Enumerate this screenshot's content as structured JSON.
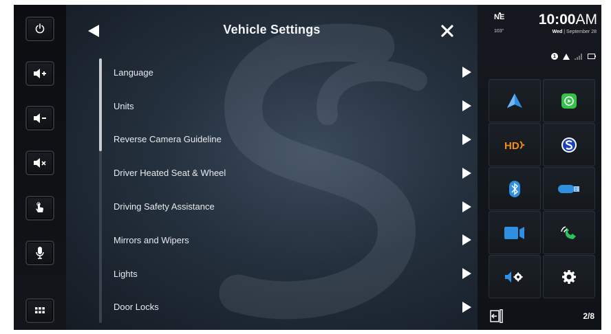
{
  "left_buttons": [
    {
      "name": "power-button",
      "icon": "power-icon"
    },
    {
      "name": "volume-up-button",
      "icon": "volume-up-icon"
    },
    {
      "name": "volume-down-button",
      "icon": "volume-down-icon"
    },
    {
      "name": "mute-button",
      "icon": "mute-icon"
    },
    {
      "name": "touch-button",
      "icon": "touch-hand-icon"
    },
    {
      "name": "voice-button",
      "icon": "microphone-icon"
    },
    {
      "name": "apps-button",
      "icon": "apps-grid-icon"
    }
  ],
  "header": {
    "title": "Vehicle Settings",
    "back_icon": "back-arrow-icon",
    "close_icon": "close-icon"
  },
  "menu": {
    "items": [
      {
        "label": "Language"
      },
      {
        "label": "Units"
      },
      {
        "label": "Reverse Camera Guideline"
      },
      {
        "label": "Driver Heated Seat & Wheel"
      },
      {
        "label": "Driving Safety Assistance"
      },
      {
        "label": "Mirrors and Wipers"
      },
      {
        "label": "Lights"
      },
      {
        "label": "Door Locks"
      }
    ],
    "scroll_fraction_visible": 0.35
  },
  "status": {
    "compass": "NE",
    "heading": "103°",
    "time": "10:00",
    "ampm": "AM",
    "day": "Wed",
    "date": "September 28",
    "notification_count": "1",
    "page": "2/8"
  },
  "tiles": [
    {
      "name": "navigation-tile",
      "icon": "navigation-arrow-icon"
    },
    {
      "name": "carplay-tile",
      "icon": "carplay-icon"
    },
    {
      "name": "hd-radio-tile",
      "icon": "hd-radio-icon"
    },
    {
      "name": "siriusxm-tile",
      "icon": "siriusxm-icon"
    },
    {
      "name": "bluetooth-tile",
      "icon": "bluetooth-icon"
    },
    {
      "name": "usb-tile",
      "icon": "usb-icon"
    },
    {
      "name": "camera-tile",
      "icon": "video-camera-icon"
    },
    {
      "name": "phone-tile",
      "icon": "phone-icon"
    },
    {
      "name": "audio-settings-tile",
      "icon": "speaker-settings-icon"
    },
    {
      "name": "settings-tile",
      "icon": "gear-icon"
    }
  ],
  "colors": {
    "accent_blue": "#2f8fe0",
    "carplay_green": "#36c24a",
    "hd_orange": "#f28b1a",
    "phone_green": "#2ec25a"
  }
}
